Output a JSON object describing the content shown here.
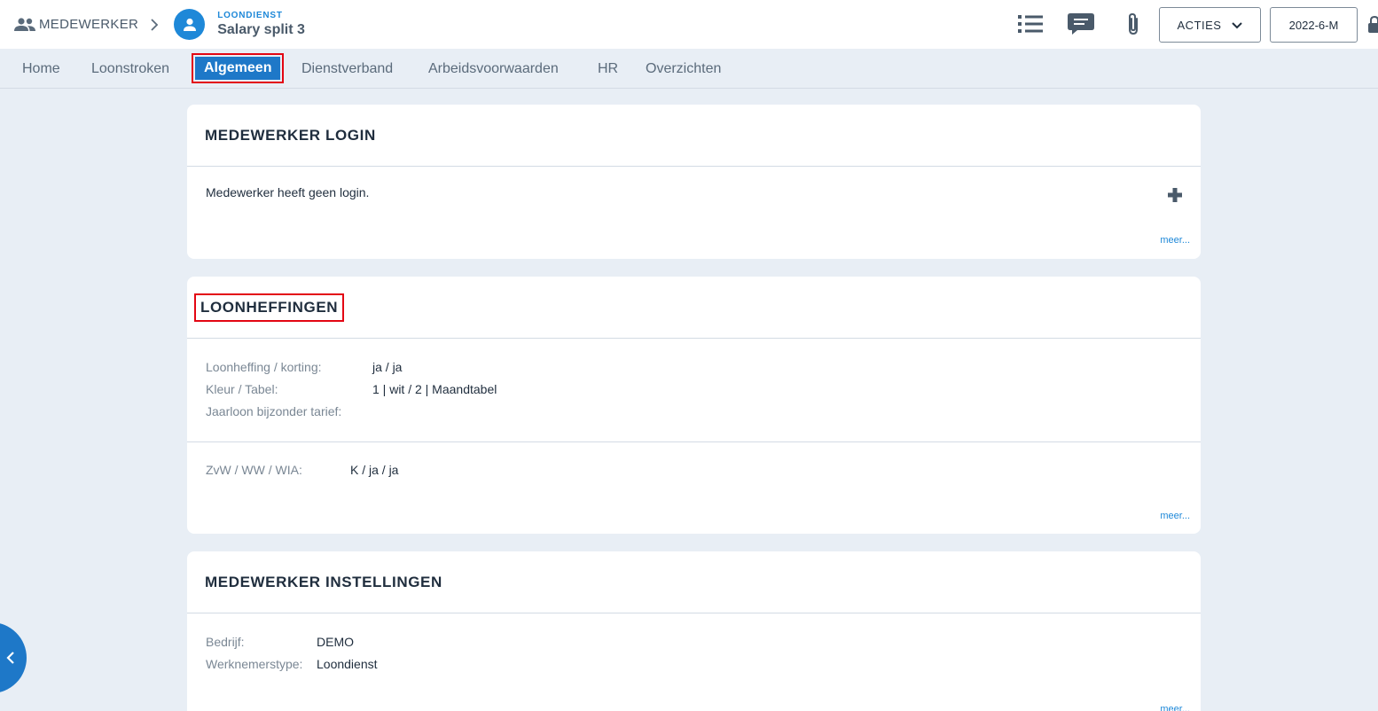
{
  "header": {
    "breadcrumb_root": "MEDEWERKER",
    "employee_subtitle": "LOONDIENST",
    "employee_name": "Salary split 3",
    "acties_label": "ACTIES",
    "period_label": "2022-6-M"
  },
  "tabs": [
    {
      "label": "Home"
    },
    {
      "label": "Loonstroken"
    },
    {
      "label": "Algemeen",
      "active": true
    },
    {
      "label": "Dienstverband"
    },
    {
      "label": "Arbeidsvoorwaarden"
    },
    {
      "label": "HR"
    },
    {
      "label": "Overzichten"
    }
  ],
  "login_card": {
    "title": "MEDEWERKER LOGIN",
    "message": "Medewerker heeft geen login.",
    "more_link": "meer..."
  },
  "loonheffingen_card": {
    "title": "LOONHEFFINGEN",
    "rows": [
      {
        "label": "Loonheffing / korting:",
        "value": "ja / ja"
      },
      {
        "label": "Kleur / Tabel:",
        "value": "1 | wit / 2 | Maandtabel"
      },
      {
        "label": "Jaarloon bijzonder tarief:",
        "value": ""
      }
    ],
    "insurance_rows": [
      {
        "label": "ZvW / WW / WIA:",
        "value": "K / ja / ja"
      }
    ],
    "more_link": "meer..."
  },
  "instellingen_card": {
    "title": "MEDEWERKER INSTELLINGEN",
    "rows": [
      {
        "label": "Bedrijf:",
        "value": "DEMO"
      },
      {
        "label": "Werknemerstype:",
        "value": "Loondienst"
      }
    ],
    "more_link": "meer..."
  },
  "colors": {
    "accent": "#1e88d8",
    "active_tab": "#1e78c8",
    "highlight_border": "#e30613",
    "background": "#e8eef5"
  },
  "icons": {
    "breadcrumb": "people-icon",
    "avatar": "person-icon",
    "list": "list-icon",
    "chat": "chat-icon",
    "attachment": "paperclip-icon",
    "add": "plus-icon",
    "lock": "lock-icon",
    "collapse": "chevron-left-icon"
  }
}
